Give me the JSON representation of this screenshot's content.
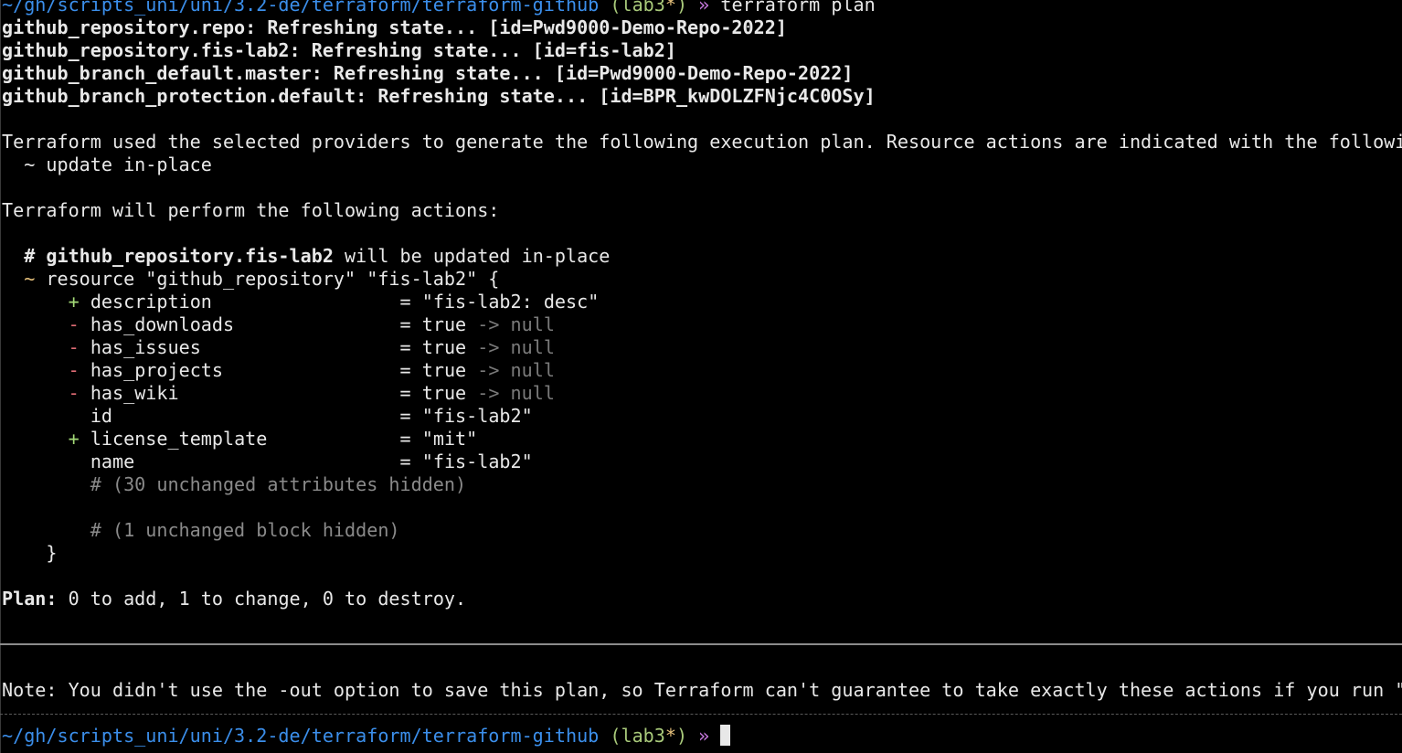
{
  "prompt": {
    "path": "~/gh/scripts_uni/uni/3.2-de/terraform/terraform-github",
    "branch_open": " (",
    "branch": "lab3",
    "dirty": "*",
    "branch_close": ")",
    "arrow": " »",
    "command": " terraform plan"
  },
  "refresh_lines": [
    "github_repository.repo: Refreshing state... [id=Pwd9000-Demo-Repo-2022]",
    "github_repository.fis-lab2: Refreshing state... [id=fis-lab2]",
    "github_branch_default.master: Refreshing state... [id=Pwd9000-Demo-Repo-2022]",
    "github_branch_protection.default: Refreshing state... [id=BPR_kwDOLZFNjc4C0OSy]"
  ],
  "intro": "Terraform used the selected providers to generate the following execution plan. Resource actions are indicated with the followin",
  "legend": "  ~ update in-place",
  "actions_heading": "Terraform will perform the following actions:",
  "resource": {
    "comment_hash": "  # ",
    "comment_name": "github_repository.fis-lab2",
    "comment_rest": " will be updated in-place",
    "header_tilde": "  ~",
    "header_text": " resource \"github_repository\" \"fis-lab2\" {",
    "attributes": [
      {
        "sign": "+",
        "kind": "add",
        "name": "description                 ",
        "eq": "= ",
        "value": "\"fis-lab2: desc\"",
        "change": ""
      },
      {
        "sign": "-",
        "kind": "remove",
        "name": "has_downloads               ",
        "eq": "= ",
        "value": "true",
        "change": " -> null"
      },
      {
        "sign": "-",
        "kind": "remove",
        "name": "has_issues                  ",
        "eq": "= ",
        "value": "true",
        "change": " -> null"
      },
      {
        "sign": "-",
        "kind": "remove",
        "name": "has_projects                ",
        "eq": "= ",
        "value": "true",
        "change": " -> null"
      },
      {
        "sign": "-",
        "kind": "remove",
        "name": "has_wiki                    ",
        "eq": "= ",
        "value": "true",
        "change": " -> null"
      },
      {
        "sign": " ",
        "kind": "same",
        "name": "id                          ",
        "eq": "= ",
        "value": "\"fis-lab2\"",
        "change": ""
      },
      {
        "sign": "+",
        "kind": "add",
        "name": "license_template            ",
        "eq": "= ",
        "value": "\"mit\"",
        "change": ""
      },
      {
        "sign": " ",
        "kind": "same",
        "name": "name                        ",
        "eq": "= ",
        "value": "\"fis-lab2\"",
        "change": ""
      }
    ],
    "hidden_attrs": "        # (30 unchanged attributes hidden)",
    "hidden_blocks": "        # (1 unchanged block hidden)",
    "close_brace": "    }"
  },
  "plan_label": "Plan:",
  "plan_text": " 0 to add, 1 to change, 0 to destroy.",
  "note": "Note: You didn't use the -out option to save this plan, so Terraform can't guarantee to take exactly these actions if you run \"t",
  "colors": {
    "background": "#000000",
    "path": "#3b8eea",
    "branch": "#a8c97a",
    "add": "#a3d977",
    "remove": "#e06c75",
    "dim": "#8a8a8a"
  }
}
